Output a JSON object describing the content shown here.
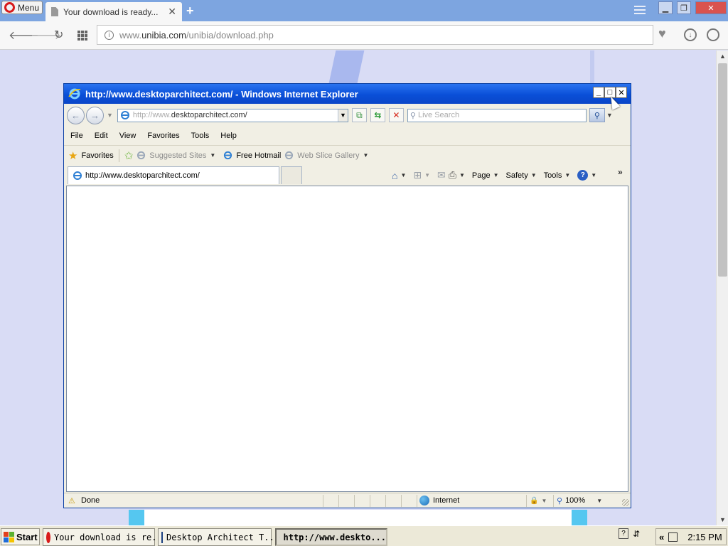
{
  "opera": {
    "menu_label": "Menu",
    "tab_title": "Your download is ready...",
    "url_prefix": "www.",
    "url_domain": "unibia.com",
    "url_path": "/unibia/download.php"
  },
  "ie": {
    "title": "http://www.desktoparchitect.com/ - Windows Internet Explorer",
    "address_prefix": "http://www.",
    "address_domain": "desktoparchitect.com",
    "address_suffix": "/",
    "search_placeholder": "Live Search",
    "menu": [
      "File",
      "Edit",
      "View",
      "Favorites",
      "Tools",
      "Help"
    ],
    "favorites": {
      "favorites_label": "Favorites",
      "suggested_sites": "Suggested Sites",
      "free_hotmail": "Free Hotmail",
      "web_slice_gallery": "Web Slice Gallery"
    },
    "tab_title": "http://www.desktoparchitect.com/",
    "commands": {
      "page": "Page",
      "safety": "Safety",
      "tools": "Tools"
    },
    "status_text": "Done",
    "zone_text": "Internet",
    "zoom_text": "100%"
  },
  "taskbar": {
    "start_label": "Start",
    "tasks": [
      {
        "label": "Your download is re..."
      },
      {
        "label": "Desktop Architect T..."
      },
      {
        "label": "http://www.deskto..."
      }
    ],
    "clock": "2:15 PM"
  },
  "icons": {
    "opera_logo": "opera-logo-icon",
    "ie_logo": "ie-logo-icon",
    "windows_logo": "windows-logo-icon"
  },
  "colors": {
    "ie_titlebar": "#0a4fd8",
    "opera_tabbar": "#7da5e0",
    "page_background": "#d9dcf5",
    "taskbar": "#ece9d8"
  }
}
